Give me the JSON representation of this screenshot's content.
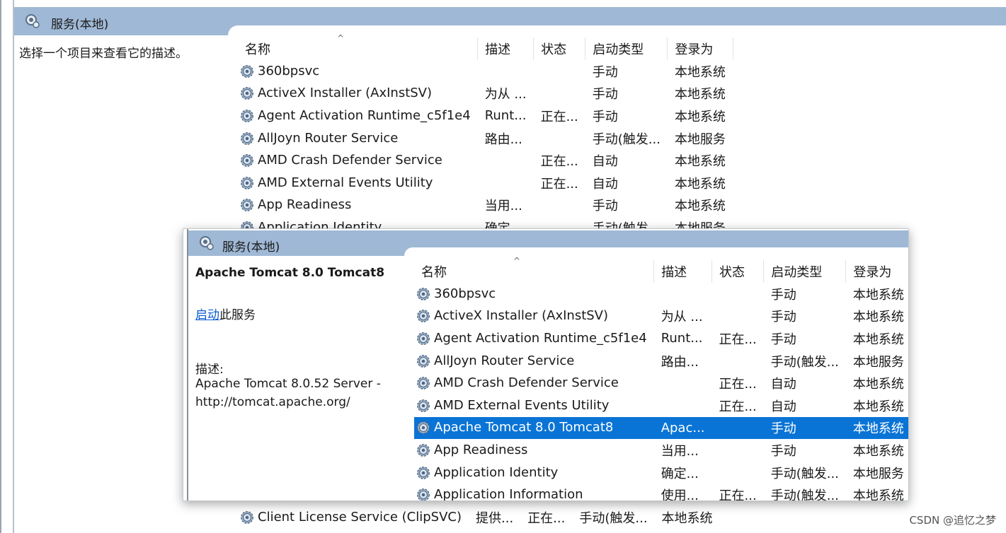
{
  "back": {
    "title": "服务(本地)",
    "hint": "选择一个项目来查看它的描述。",
    "columns": [
      "名称",
      "描述",
      "状态",
      "启动类型",
      "登录为"
    ],
    "rows": [
      {
        "name": "360bpsvc",
        "desc": "",
        "status": "",
        "startup": "手动",
        "logon": "本地系统"
      },
      {
        "name": "ActiveX Installer (AxInstSV)",
        "desc": "为从 ...",
        "status": "",
        "startup": "手动",
        "logon": "本地系统"
      },
      {
        "name": "Agent Activation Runtime_c5f1e4",
        "desc": "Runt...",
        "status": "正在...",
        "startup": "手动",
        "logon": "本地系统"
      },
      {
        "name": "AllJoyn Router Service",
        "desc": "路由...",
        "status": "",
        "startup": "手动(触发...",
        "logon": "本地服务"
      },
      {
        "name": "AMD Crash Defender Service",
        "desc": "",
        "status": "正在...",
        "startup": "自动",
        "logon": "本地系统"
      },
      {
        "name": "AMD External Events Utility",
        "desc": "",
        "status": "正在...",
        "startup": "自动",
        "logon": "本地系统"
      },
      {
        "name": "App Readiness",
        "desc": "当用...",
        "status": "",
        "startup": "手动",
        "logon": "本地系统"
      },
      {
        "name": "Application Identity",
        "desc": "确定...",
        "status": "",
        "startup": "手动(触发...",
        "logon": "本地服务"
      }
    ],
    "bottom_row": {
      "name": "Client License Service (ClipSVC)",
      "desc": "提供...",
      "status": "正在...",
      "startup": "手动(触发...",
      "logon": "本地系统"
    }
  },
  "front": {
    "title": "服务(本地)",
    "selected_name": "Apache Tomcat 8.0 Tomcat8",
    "action_link": "启动",
    "action_suffix": "此服务",
    "desc_label": "描述:",
    "desc_line1": "Apache Tomcat 8.0.52 Server -",
    "desc_line2": "http://tomcat.apache.org/",
    "columns": [
      "名称",
      "描述",
      "状态",
      "启动类型",
      "登录为"
    ],
    "rows": [
      {
        "name": "360bpsvc",
        "desc": "",
        "status": "",
        "startup": "手动",
        "logon": "本地系统"
      },
      {
        "name": "ActiveX Installer (AxInstSV)",
        "desc": "为从 ...",
        "status": "",
        "startup": "手动",
        "logon": "本地系统"
      },
      {
        "name": "Agent Activation Runtime_c5f1e4",
        "desc": "Runt...",
        "status": "正在...",
        "startup": "手动",
        "logon": "本地系统"
      },
      {
        "name": "AllJoyn Router Service",
        "desc": "路由...",
        "status": "",
        "startup": "手动(触发...",
        "logon": "本地服务"
      },
      {
        "name": "AMD Crash Defender Service",
        "desc": "",
        "status": "正在...",
        "startup": "自动",
        "logon": "本地系统"
      },
      {
        "name": "AMD External Events Utility",
        "desc": "",
        "status": "正在...",
        "startup": "自动",
        "logon": "本地系统"
      },
      {
        "name": "Apache Tomcat 8.0 Tomcat8",
        "desc": "Apac...",
        "status": "",
        "startup": "手动",
        "logon": "本地系统",
        "selected": true
      },
      {
        "name": "App Readiness",
        "desc": "当用...",
        "status": "",
        "startup": "手动",
        "logon": "本地系统"
      },
      {
        "name": "Application Identity",
        "desc": "确定...",
        "status": "",
        "startup": "手动(触发...",
        "logon": "本地服务"
      },
      {
        "name": "Application Information",
        "desc": "使用...",
        "status": "正在...",
        "startup": "手动(触发...",
        "logon": "本地系统"
      }
    ]
  },
  "watermark": "CSDN @追忆之梦",
  "colors": {
    "titlebar": "#9fb8d5",
    "selection": "#0a74d6",
    "link": "#0a5bd0"
  },
  "icons": {
    "title": "services-icon",
    "row": "gear-icon"
  }
}
